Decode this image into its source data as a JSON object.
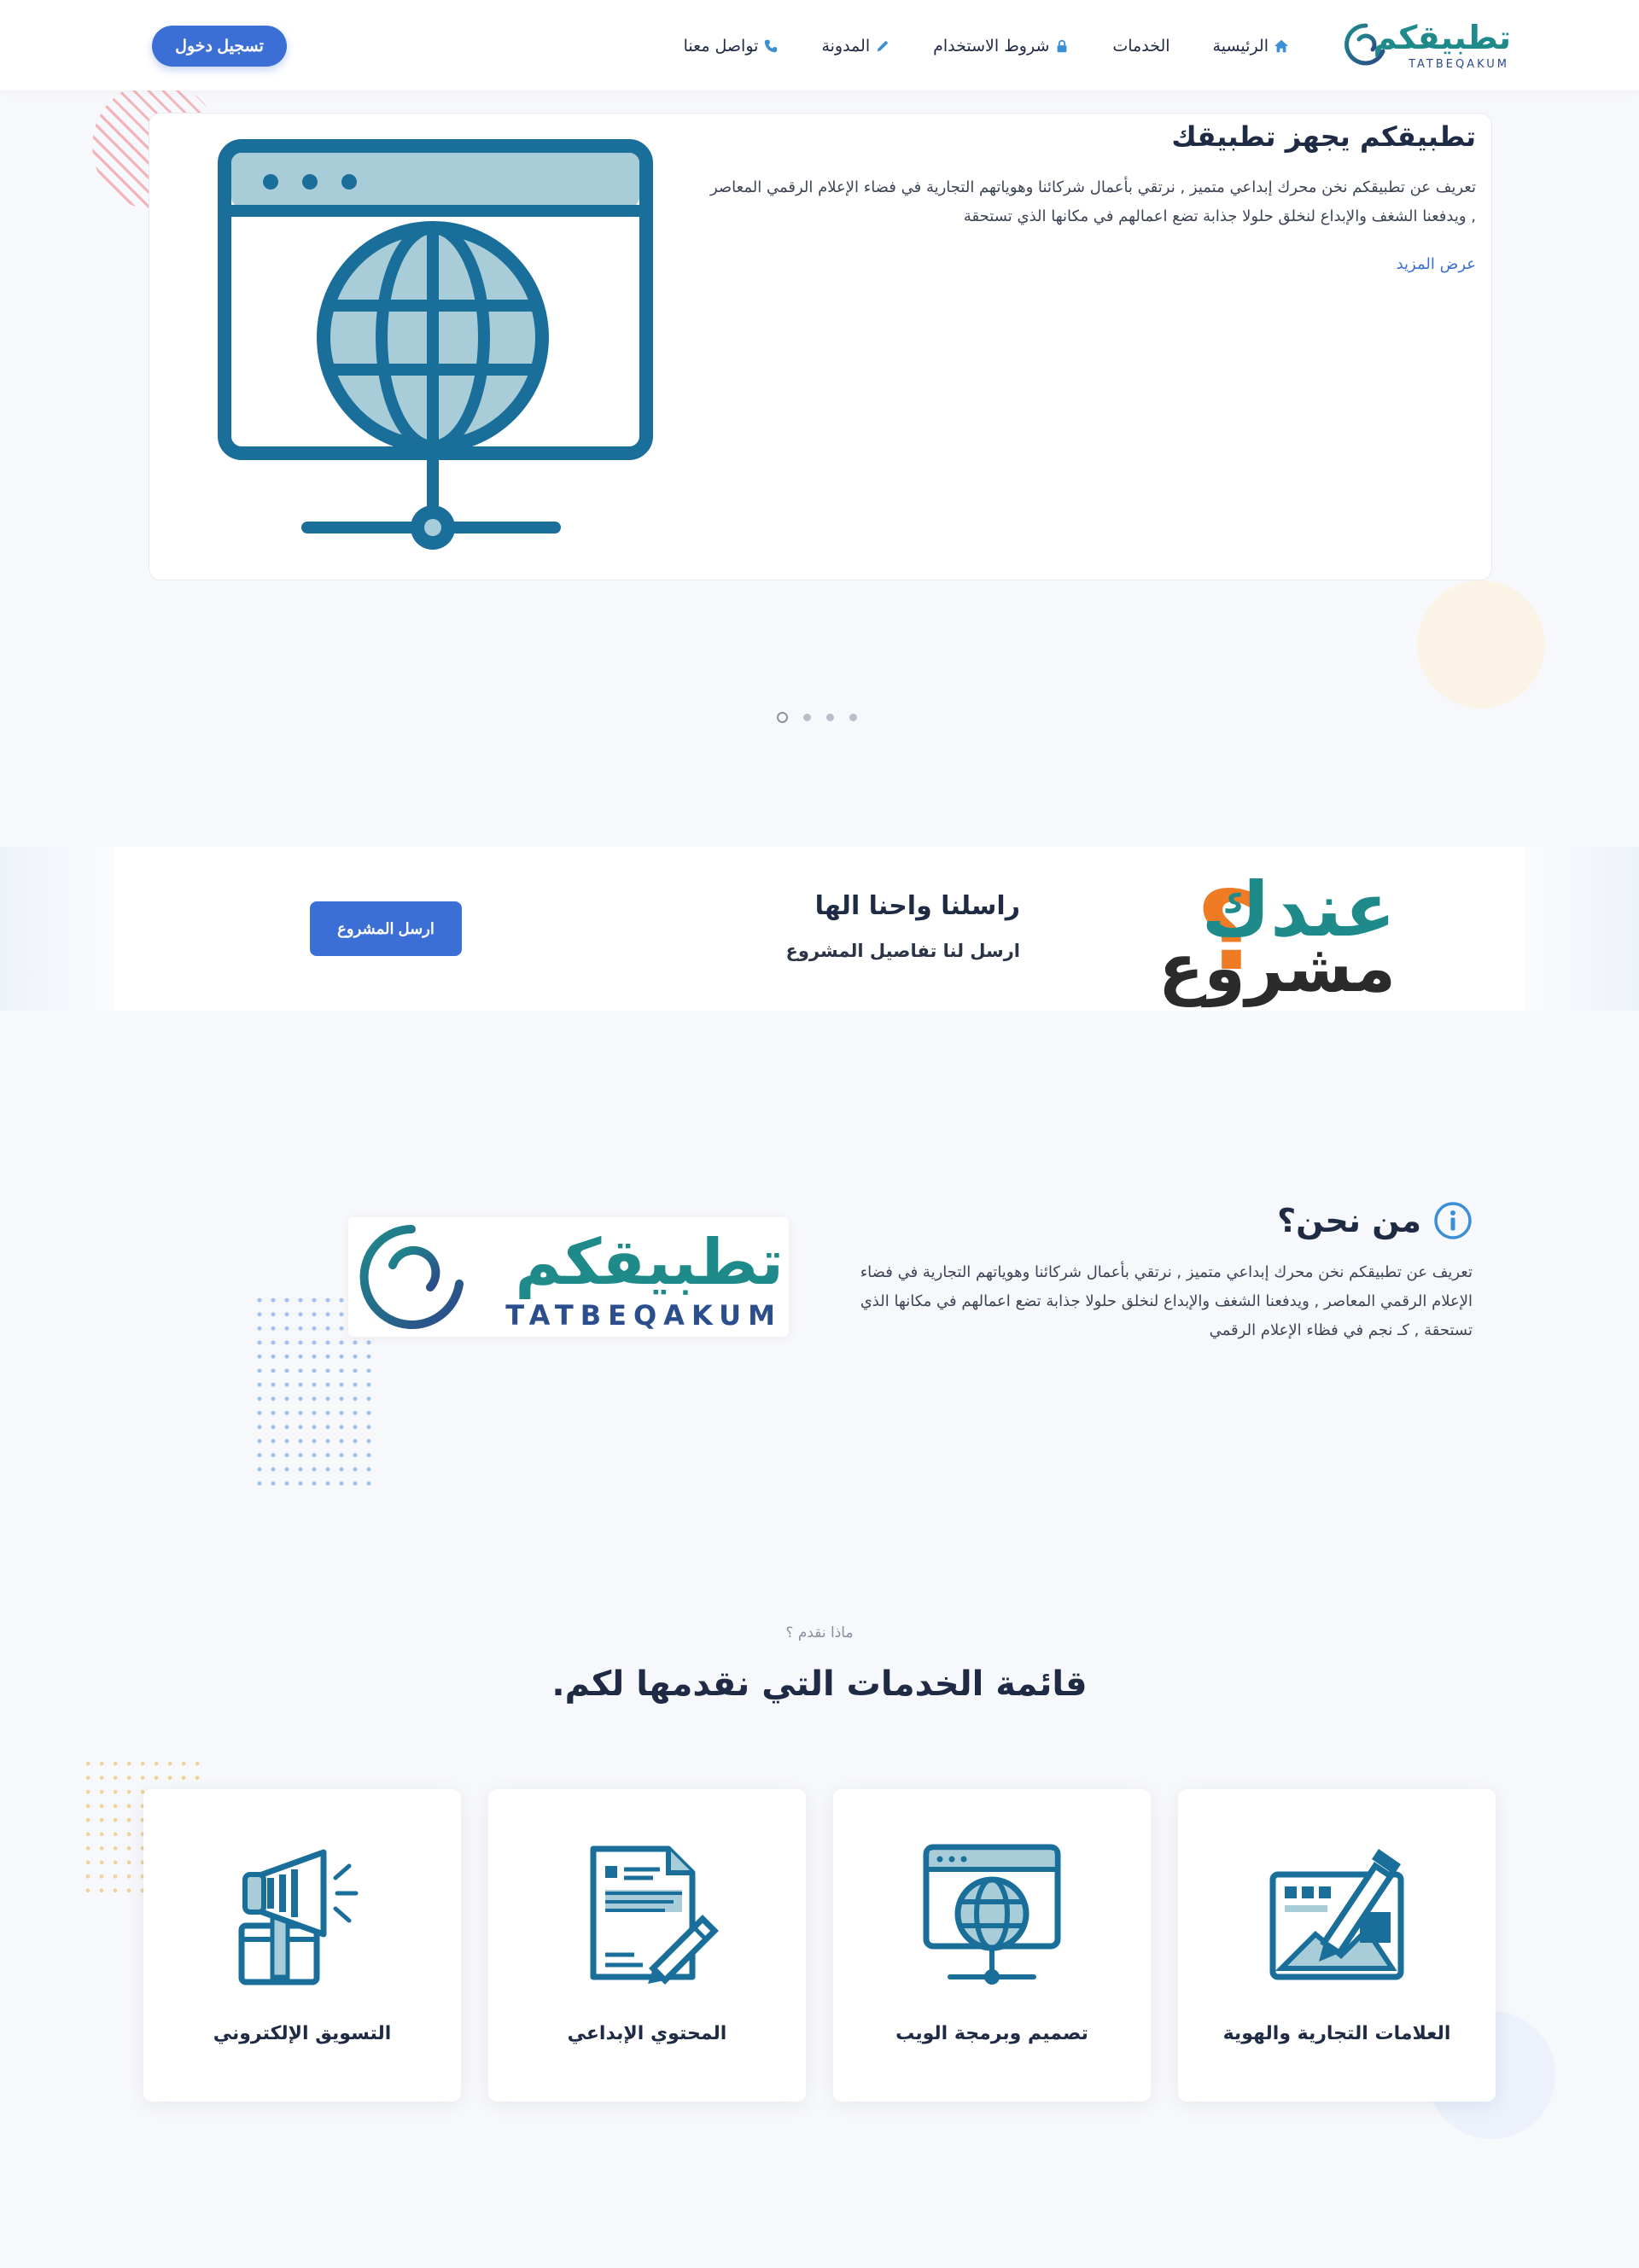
{
  "nav": {
    "logo_arabic": "تطبيقكم",
    "logo_latin": "TATBEQAKUM",
    "items": [
      {
        "label": "الرئيسية",
        "icon": "home-icon"
      },
      {
        "label": "الخدمات",
        "icon": ""
      },
      {
        "label": "شروط الاستخدام",
        "icon": "lock-icon"
      },
      {
        "label": "المدونة",
        "icon": "pencil-icon"
      },
      {
        "label": "تواصل معنا",
        "icon": "phone-icon"
      }
    ],
    "login_label": "تسجيل دخول"
  },
  "hero": {
    "title": "تطبيقكم يجهز تطبيقك",
    "text": "تعريف عن تطبيقكم نخن محرك إبداعي متميز , نرتقي بأعمال شركائنا وهوياتهم التجارية في فضاء الإعلام الرقمي المعاصر , ويدفعنا الشغف والإبداع لنخلق حلولا جذابة تضع اعمالهم في مكانها الذي تستحقة",
    "more_label": "عرض المزيد",
    "slides_count": 4,
    "active_slide": 1
  },
  "cta": {
    "graphic_line1": "عندك",
    "graphic_line2": "مشروع",
    "graphic_mark": "؟",
    "title": "راسلنا واحنا الها",
    "subtitle": "ارسل لنا تفاصيل المشروع",
    "button_label": "ارسل المشروع"
  },
  "about": {
    "title": "من نحن؟",
    "text": "تعريف عن تطبيقكم نخن محرك إبداعي متميز , نرتقي بأعمال شركائنا وهوياتهم التجارية في فضاء الإعلام الرقمي المعاصر , ويدفعنا الشغف والإبداع لنخلق حلولا جذابة تضع اعمالهم في مكانها الذي تستحقة , كـ نجم في فظاء الإعلام الرقمي",
    "logo_arabic": "تطبيقكم",
    "logo_latin": "TATBEQAKUM"
  },
  "services": {
    "kicker": "ماذا نقدم ؟",
    "title": "قائمة الخدمات التي نقدمها لكم.",
    "items": [
      {
        "label": "العلامات التجارية والهوية",
        "icon": "brand-design-icon"
      },
      {
        "label": "تصميم وبرمجة الويب",
        "icon": "web-globe-icon"
      },
      {
        "label": "المحتوي الإبداعي",
        "icon": "content-writing-icon"
      },
      {
        "label": "التسويق الإلكتروني",
        "icon": "megaphone-icon"
      }
    ]
  },
  "colors": {
    "primary": "#3b6fd6",
    "teal": "#1e8a8a",
    "icon_blue": "#1a6f9a",
    "icon_light": "#a8cdd8",
    "orange": "#ef7b25"
  }
}
